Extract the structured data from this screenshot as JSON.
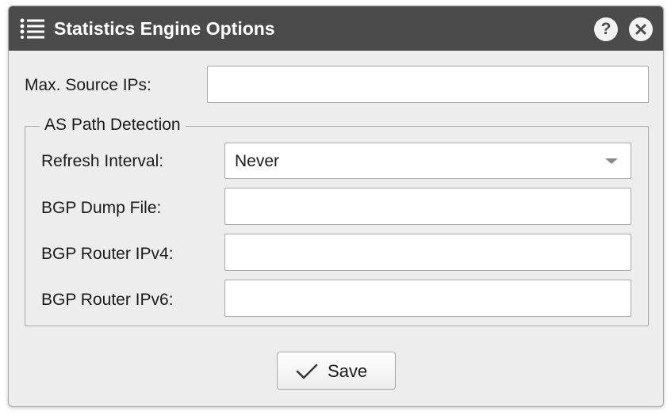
{
  "dialog": {
    "title": "Statistics Engine Options",
    "help_icon": "question-mark-icon",
    "close_icon": "close-x-icon",
    "menu_icon": "list-icon"
  },
  "fields": {
    "max_source_ips": {
      "label": "Max. Source IPs:",
      "value": "",
      "placeholder": ""
    }
  },
  "as_path_detection": {
    "legend": "AS Path Detection",
    "refresh_interval": {
      "label": "Refresh Interval:",
      "selected": "Never"
    },
    "bgp_dump_file": {
      "label": "BGP Dump File:",
      "value": ""
    },
    "bgp_router_ipv4": {
      "label": "BGP Router IPv4:",
      "value": ""
    },
    "bgp_router_ipv6": {
      "label": "BGP Router IPv6:",
      "value": ""
    }
  },
  "actions": {
    "save_label": "Save",
    "save_icon": "checkmark-icon"
  },
  "colors": {
    "titlebar": "#4b4b4b",
    "body": "#ededed",
    "border": "#a9a9a9"
  }
}
